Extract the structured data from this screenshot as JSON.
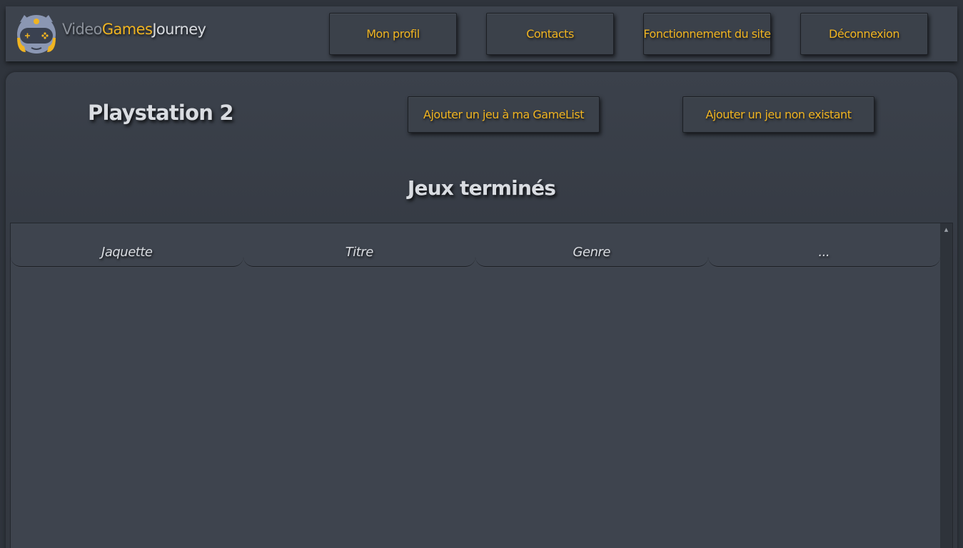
{
  "header": {
    "brand": {
      "part1": "Video",
      "part2": "Games",
      "part3": "Journey"
    },
    "logo_icon": "gamepad-mascot-icon",
    "nav": [
      {
        "label": "Mon profil"
      },
      {
        "label": "Contacts"
      },
      {
        "label": "Fonctionnement du site"
      },
      {
        "label": "Déconnexion"
      }
    ]
  },
  "main": {
    "platform_title": "Playstation 2",
    "add_to_gamelist_label": "Ajouter un jeu à ma GameList",
    "add_new_game_label": "Ajouter un jeu non existant",
    "section_title": "Jeux terminés",
    "table": {
      "columns": [
        "Jaquette",
        "Titre",
        "Genre",
        "..."
      ],
      "rows": []
    },
    "scroll_up_icon": "chevron-up-icon"
  },
  "colors": {
    "accent": "#f0b421",
    "background": "#2f343c",
    "panel": "#3d434d",
    "text": "#d9dce1"
  }
}
